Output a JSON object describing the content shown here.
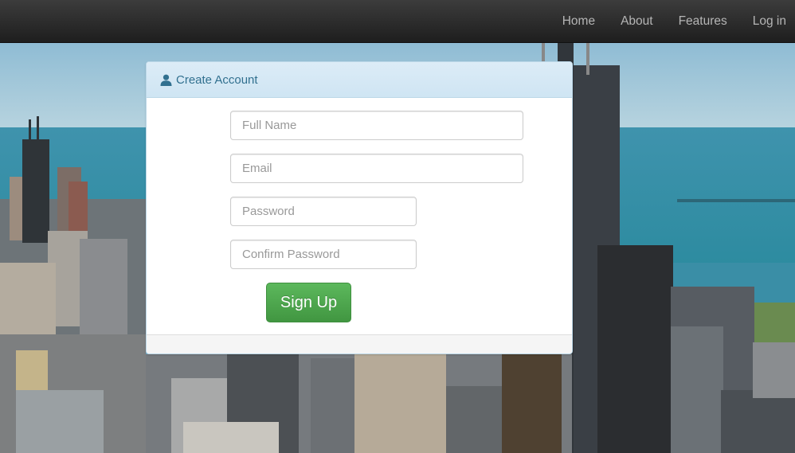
{
  "navbar": {
    "links": [
      {
        "label": "Home"
      },
      {
        "label": "About"
      },
      {
        "label": "Features"
      },
      {
        "label": "Log in"
      }
    ]
  },
  "panel": {
    "heading": "Create Account",
    "heading_icon": "user-icon",
    "fields": {
      "full_name": {
        "placeholder": "Full Name",
        "value": ""
      },
      "email": {
        "placeholder": "Email",
        "value": ""
      },
      "password": {
        "placeholder": "Password",
        "value": ""
      },
      "confirm_password": {
        "placeholder": "Confirm Password",
        "value": ""
      }
    },
    "submit_label": "Sign Up"
  },
  "colors": {
    "navbar": "#2a2a2a",
    "panel_heading": "#d9ecf7",
    "heading_text": "#31708f",
    "button": "#4cae4c"
  }
}
